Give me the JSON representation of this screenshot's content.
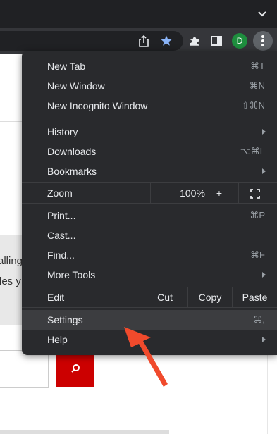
{
  "browser": {
    "profile_initial": "D",
    "menu_items": [
      {
        "label": "New Tab",
        "shortcut": "⌘T"
      },
      {
        "label": "New Window",
        "shortcut": "⌘N"
      },
      {
        "label": "New Incognito Window",
        "shortcut": "⇧⌘N"
      },
      {
        "label": "History",
        "shortcut": ""
      },
      {
        "label": "Downloads",
        "shortcut": "⌥⌘L"
      },
      {
        "label": "Bookmarks",
        "shortcut": ""
      },
      {
        "label": "Print...",
        "shortcut": "⌘P"
      },
      {
        "label": "Cast...",
        "shortcut": ""
      },
      {
        "label": "Find...",
        "shortcut": "⌘F"
      },
      {
        "label": "More Tools",
        "shortcut": ""
      },
      {
        "label": "Settings",
        "shortcut": "⌘,"
      },
      {
        "label": "Help",
        "shortcut": ""
      }
    ],
    "zoom": {
      "label": "Zoom",
      "minus": "–",
      "value": "100%",
      "plus": "+"
    },
    "edit": {
      "label": "Edit",
      "cut": "Cut",
      "copy": "Copy",
      "paste": "Paste"
    }
  },
  "page": {
    "text_line1": "alling",
    "text_line2": "les y"
  },
  "colors": {
    "menu_bg": "#292a2d",
    "highlight": "#3c3d40",
    "pointer_arrow": "#f04a2c",
    "search_button": "#c00000"
  }
}
